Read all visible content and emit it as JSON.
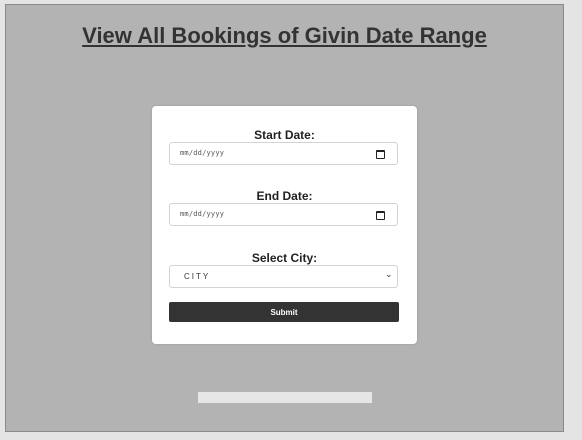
{
  "page": {
    "title": "View All Bookings of Givin Date Range"
  },
  "form": {
    "start_date": {
      "label": "Start Date:",
      "placeholder": "mm/dd/yyyy",
      "icon": "calendar-icon"
    },
    "end_date": {
      "label": "End Date:",
      "placeholder": "mm/dd/yyyy",
      "icon": "calendar-icon"
    },
    "city": {
      "label": "Select City:",
      "value": "CITY",
      "icon": "chevron-down-icon"
    },
    "submit_label": "Submit"
  },
  "colors": {
    "page_background": "#e4e4e4",
    "panel_background": "#b3b3b3",
    "card_background": "#ffffff",
    "button_background": "#333333",
    "button_text": "#ffffff",
    "title_text": "#333333"
  }
}
